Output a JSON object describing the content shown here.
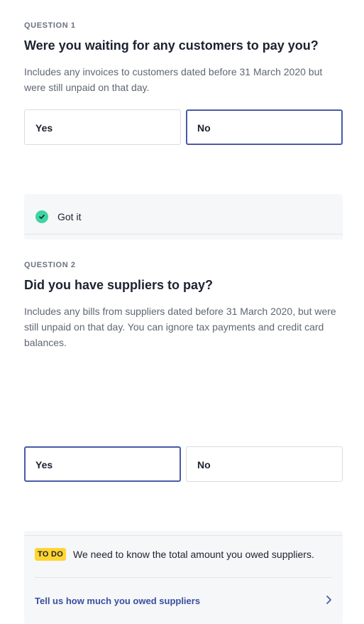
{
  "question1": {
    "label": "QUESTION 1",
    "title": "Were you waiting for any customers to pay you?",
    "description": "Includes any invoices to customers dated before 31 March 2020 but were still unpaid on that day.",
    "options": [
      {
        "label": "Yes",
        "selected": false
      },
      {
        "label": "No",
        "selected": true
      }
    ],
    "feedback": {
      "icon": "check-circle-icon",
      "text": "Got it",
      "color": "#3ed5a3"
    }
  },
  "question2": {
    "label": "QUESTION 2",
    "title": "Did you have suppliers to pay?",
    "description": "Includes any bills from suppliers dated before 31 March 2020, but were still unpaid on that day. You can ignore tax payments and credit card balances.",
    "options": [
      {
        "label": "Yes",
        "selected": true
      },
      {
        "label": "No",
        "selected": false
      }
    ],
    "todo": {
      "badge": "TO DO",
      "text": "We need to know the total amount you owed suppliers.",
      "badge_color": "#ffd531",
      "link_label": "Tell us how much you owed suppliers",
      "link_icon": "chevron-right-icon"
    }
  },
  "colors": {
    "accent": "#4a5aa8",
    "link": "#3b4ea1",
    "success": "#3ed5a3",
    "todo": "#ffd531"
  }
}
